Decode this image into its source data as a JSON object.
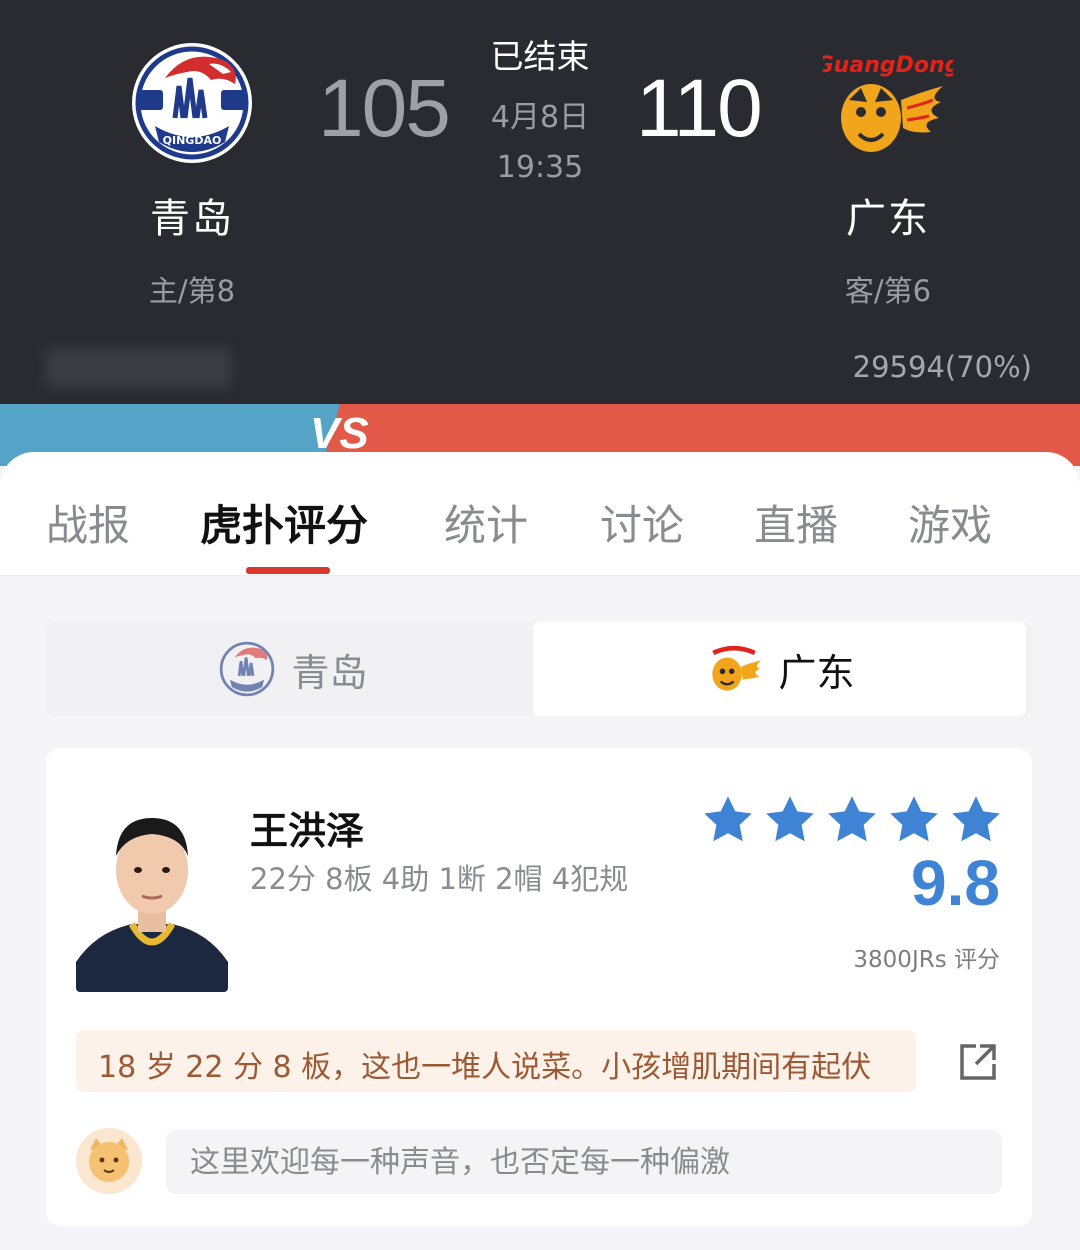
{
  "header": {
    "status": "已结束",
    "date": "4月8日",
    "time": "19:35",
    "home": {
      "name": "青岛",
      "score": "105",
      "meta": "主/第8",
      "logo_icon": "qingdao-eagle-logo-icon",
      "logo_text": "QINGDAO"
    },
    "away": {
      "name": "广东",
      "score": "110",
      "meta": "客/第6",
      "logo_icon": "guangdong-tiger-logo-icon",
      "logo_text": "GuangDong"
    },
    "away_support": "29594(70%)",
    "vs_text": "VS"
  },
  "tabs": [
    {
      "label": "战报"
    },
    {
      "label": "虎扑评分"
    },
    {
      "label": "统计"
    },
    {
      "label": "讨论"
    },
    {
      "label": "直播"
    },
    {
      "label": "游戏"
    }
  ],
  "team_switch": {
    "left": {
      "name": "青岛"
    },
    "right": {
      "name": "广东"
    }
  },
  "player": {
    "name": "王洪泽",
    "stats": "22分 8板 4助 1断 2帽 4犯规",
    "rating": "9.8",
    "stars": 5,
    "rating_count": "3800JRs 评分",
    "top_comment": "18 岁 22 分 8 板，这也一堆人说菜。小孩增肌期间有起伏",
    "reply_placeholder": "这里欢迎每一种声音，也否定每一种偏激"
  },
  "colors": {
    "accent_red": "#d9382e",
    "rating_blue": "#3f84d4",
    "vs_blue": "#56a3c8",
    "vs_red": "#e25a47"
  }
}
